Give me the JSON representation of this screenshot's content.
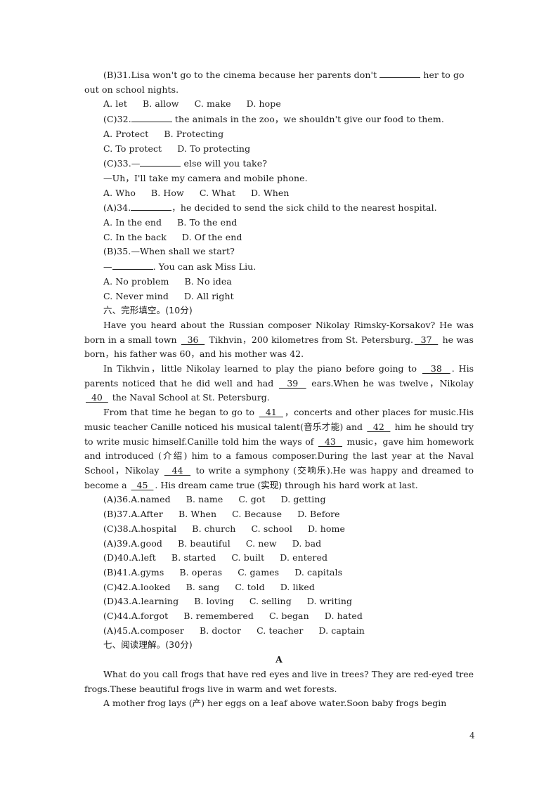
{
  "mc_questions": [
    {
      "answer": "(B)",
      "number": "31.",
      "stem_before": "Lisa won't go to the cinema because her parents don't ",
      "stem_after": " her to go",
      "stem_cont": "out on school nights.",
      "options_rows": [
        [
          "A. let",
          "B. allow",
          "C. make",
          "D. hope"
        ]
      ]
    },
    {
      "answer": "(C)",
      "number": "32.",
      "stem_before": "",
      "stem_after": " the animals in the zoo，we shouldn't give our food to them.",
      "options_rows": [
        [
          "A. Protect",
          "B. Protecting"
        ],
        [
          "C. To protect",
          "D. To protecting"
        ]
      ]
    },
    {
      "answer": "(C)",
      "number": "33.",
      "stem_before": "—",
      "stem_after": " else will you take?",
      "dialog": "—Uh，I'll take my camera and mobile phone.",
      "options_rows": [
        [
          "A. Who",
          "B. How",
          "C. What",
          "D. When"
        ]
      ]
    },
    {
      "answer": "(A)",
      "number": "34.",
      "stem_before": "",
      "stem_after": "，he decided to send the sick child to the nearest hospital.",
      "options_rows": [
        [
          "A. In the end",
          "B. To the end"
        ],
        [
          "C. In the back",
          "D. Of the end"
        ]
      ]
    },
    {
      "answer": "(B)",
      "number": "35.",
      "stem_before": "—When shall we start?",
      "dialog_before": "—",
      "dialog_after": ". You can ask Miss Liu.",
      "options_rows": [
        [
          "A. No problem",
          "B. No idea"
        ],
        [
          "C. Never mind",
          "D. All right"
        ]
      ]
    }
  ],
  "section6": {
    "heading": "六、完形填空。(10分)",
    "p1": {
      "a": "Have you heard about the Russian composer Nikolay Rimsky-Korsakov? He was born in a small town ",
      "b36": "36",
      "c": " Tikhvin，200 kilometres from St. Petersburg.",
      "b37": "37",
      "d": " he was born，his father was 60，and his mother was 42."
    },
    "p2": {
      "a": "In Tikhvin，little Nikolay learned to play the piano before going to ",
      "b38": "38",
      "c": ". His parents noticed that he did well and had ",
      "b39": "39",
      "d": " ears.When he was twelve，Nikolay ",
      "b40": "40",
      "e": " the Naval School at St. Petersburg."
    },
    "p3": {
      "a": "From that time he began to go to ",
      "b41": "41",
      "c": "，concerts and other places for music.His music teacher Canille noticed his musical talent(音乐才能) and ",
      "b42": "42",
      "d": " him he should try to write music himself.Canille told him the ways of ",
      "b43": "43",
      "e": " music，gave him homework and introduced (介绍) him to a famous composer.During the last year at the Naval School，Nikolay ",
      "b44": "44",
      "f": " to write a symphony (交响乐).He was happy and dreamed to become a ",
      "b45": "45",
      "g": ". His dream came true (实现) through his hard work at last."
    },
    "questions": [
      {
        "answer": "(A)",
        "number": "36.",
        "options": [
          "A.named",
          "B. name",
          "C. got",
          "D. getting"
        ]
      },
      {
        "answer": "(B)",
        "number": "37.",
        "options": [
          "A.After",
          "B. When",
          "C. Because",
          "D. Before"
        ]
      },
      {
        "answer": "(C)",
        "number": "38.",
        "options": [
          "A.hospital",
          "B. church",
          "C. school",
          "D. home"
        ]
      },
      {
        "answer": "(A)",
        "number": "39.",
        "options": [
          "A.good",
          "B. beautiful",
          "C. new",
          "D. bad"
        ]
      },
      {
        "answer": "(D)",
        "number": "40.",
        "options": [
          "A.left",
          "B. started",
          "C. built",
          "D. entered"
        ]
      },
      {
        "answer": "(B)",
        "number": "41.",
        "options": [
          "A.gyms",
          "B. operas",
          "C. games",
          "D. capitals"
        ]
      },
      {
        "answer": "(C)",
        "number": "42.",
        "options": [
          "A.looked",
          "B. sang",
          "C. told",
          "D. liked"
        ]
      },
      {
        "answer": "(D)",
        "number": "43.",
        "options": [
          "A.learning",
          "B. loving",
          "C. selling",
          "D. writing"
        ]
      },
      {
        "answer": "(C)",
        "number": "44.",
        "options": [
          "A.forgot",
          "B. remembered",
          "C. began",
          "D. hated"
        ]
      },
      {
        "answer": "(A)",
        "number": "45.",
        "options": [
          "A.composer",
          "B. doctor",
          "C. teacher",
          "D. captain"
        ]
      }
    ]
  },
  "section7": {
    "heading": "七、阅读理解。(30分)",
    "passage_title": "A",
    "p1": "What do you call frogs that have red eyes and live in trees? They are red-eyed tree frogs.These beautiful frogs live in warm and wet forests.",
    "p2": "A mother frog lays (产) her eggs on a leaf above water.Soon baby frogs begin"
  },
  "page_number": "4"
}
